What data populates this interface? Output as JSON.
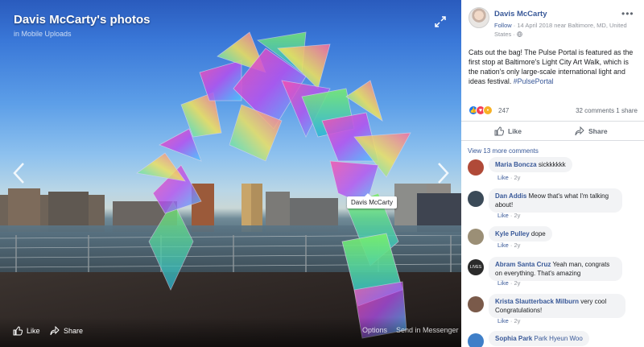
{
  "photo": {
    "album_title": "Davis McCarty's photos",
    "album_sub": "in Mobile Uploads",
    "tag_name": "Davis McCarty",
    "bottom": {
      "like": "Like",
      "share": "Share",
      "options": "Options",
      "send": "Send in Messenger"
    }
  },
  "post": {
    "author": "Davis McCarty",
    "follow": "Follow",
    "meta": " · 14 April 2018 near Baltimore, MD, United States · ",
    "caption": "Cats out the bag! The Pulse Portal is featured as the first stop at Baltimore's Light City Art Walk, which is the nation's only large-scale international light and ideas festival. ",
    "hashtag": "#PulsePortal",
    "reaction_count": "247",
    "comments_shares": "32 comments  1 share",
    "like_label": "Like",
    "share_label": "Share",
    "view_more": "View 13 more comments"
  },
  "comments": [
    {
      "name": "Maria Boncza",
      "text": "sickkkkkk",
      "time": "2y",
      "like": "Like",
      "avatar_color": "#b04a38"
    },
    {
      "name": "Dan Addis",
      "text": "Meow that's what I'm talking about!",
      "time": "2y",
      "like": "Like",
      "avatar_color": "#3b4a58"
    },
    {
      "name": "Kyle Pulley",
      "text": "dope",
      "time": "2y",
      "like": "Like",
      "avatar_color": "#9b8f76"
    },
    {
      "name": "Abram Santa Cruz",
      "text": "Yeah man, congrats on everything. That's amazing",
      "time": "2y",
      "like": "Like",
      "avatar_color": "#2b2b2b",
      "avatar_text": "LIVES"
    },
    {
      "name": "Krista Slautterback Milburn",
      "text": "very cool Congratulations!",
      "time": "2y",
      "like": "Like",
      "avatar_color": "#7a5a4a"
    },
    {
      "name": "Sophia Park",
      "text": "Park Hyeun Woo",
      "time": "",
      "like": "",
      "avatar_color": "#3f7fc8"
    }
  ],
  "colors": {
    "link": "#385898",
    "bubble": "#f2f3f5",
    "like_reaction": "#1877f2",
    "love_reaction": "#f33e58",
    "wow_reaction": "#f7b125"
  }
}
